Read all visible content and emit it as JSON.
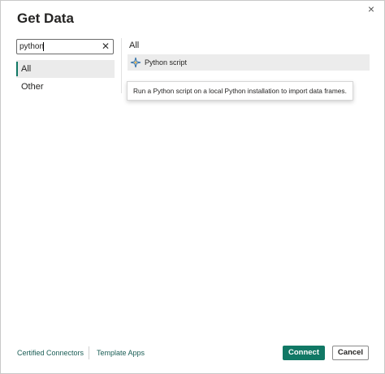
{
  "dialog": {
    "title": "Get Data",
    "close_glyph": "×"
  },
  "search": {
    "value": "python",
    "clear_glyph": "✕"
  },
  "categories": [
    {
      "label": "All",
      "selected": true
    },
    {
      "label": "Other",
      "selected": false
    }
  ],
  "results": {
    "section_title": "All",
    "items": [
      {
        "label": "Python script",
        "icon": "python-script-icon"
      }
    ]
  },
  "tooltip": {
    "text": "Run a Python script on a local Python installation to import data frames."
  },
  "footer": {
    "links": [
      {
        "label": "Certified Connectors"
      },
      {
        "label": "Template Apps"
      }
    ],
    "connect_label": "Connect",
    "cancel_label": "Cancel"
  },
  "colors": {
    "accent": "#117865",
    "link": "#1a5d55",
    "selected_bg": "#ebebeb"
  }
}
